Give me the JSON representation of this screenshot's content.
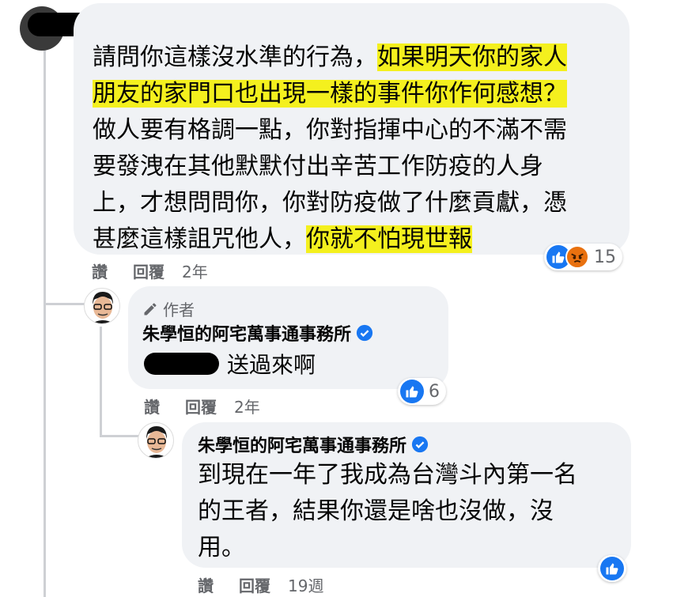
{
  "comment1": {
    "lines": [
      [
        {
          "t": "請問你這樣沒水準的行為，",
          "hl": false
        },
        {
          "t": "如果明天你的家人",
          "hl": true
        }
      ],
      [
        {
          "t": "朋友的家門口也出現一樣的事件你作何感想？",
          "hl": true
        }
      ],
      [
        {
          "t": "做人要有格調一點，你對指揮中心的不滿不需",
          "hl": false
        }
      ],
      [
        {
          "t": "要發洩在其他默默付出辛苦工作防疫的人身",
          "hl": false
        }
      ],
      [
        {
          "t": "上，才想問問你，你對防疫做了什麼貢獻，憑",
          "hl": false
        }
      ],
      [
        {
          "t": "甚麼這樣詛咒他人，",
          "hl": false
        },
        {
          "t": "你就不怕現世報",
          "hl": true
        }
      ]
    ],
    "actions": {
      "like": "讚",
      "reply": "回覆",
      "time": "2年"
    },
    "reactions": {
      "icons": [
        "like-icon",
        "angry-icon"
      ],
      "count": "15"
    }
  },
  "reply1": {
    "badge": "作者",
    "author": "朱學恒的阿宅萬事通事務所",
    "text": "送過來啊",
    "actions": {
      "like": "讚",
      "reply": "回覆",
      "time": "2年"
    },
    "reactions": {
      "icons": [
        "like-icon"
      ],
      "count": "6"
    }
  },
  "reply2": {
    "author": "朱學恒的阿宅萬事通事務所",
    "lines": [
      "到現在一年了我成為台灣斗內第一名",
      "的王者，結果你還是啥也沒做，沒",
      "用。"
    ],
    "actions": {
      "like": "讚",
      "reply": "回覆",
      "time": "19週"
    },
    "reactions": {
      "icons": [
        "like-icon"
      ]
    }
  },
  "colors": {
    "highlight": "#f4f01e",
    "like_blue": "#1877f2",
    "angry_orange": "#e9710f",
    "verified_blue": "#1877f2"
  }
}
